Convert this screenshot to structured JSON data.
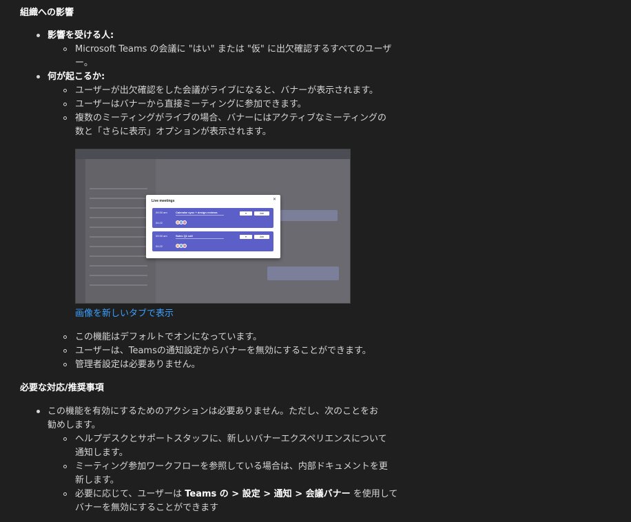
{
  "section1": {
    "heading": "組織への影響",
    "who": {
      "label": "影響を受ける人:",
      "items": [
        [
          "Microsoft Teams の会議に \"はい\" または \"仮\" に出欠確認するすべてのユーザ",
          "ー。"
        ]
      ]
    },
    "what": {
      "label": "何が起こるか:",
      "items": [
        [
          "ユーザーが出欠確認をした会議がライブになると、バナーが表示されます。"
        ],
        [
          "ユーザーはバナーから直接ミーティングに参加できます。"
        ],
        [
          "複数のミーティングがライブの場合、バナーにはアクティブなミーティングの",
          "数と「さらに表示」オプションが表示されます。"
        ]
      ],
      "image_link": "画像を新しいタブで表示",
      "after_items": [
        "この機能はデフォルトでオンになっています。",
        "ユーザーは、Teamsの通知設定からバナーを無効にすることができます。",
        "管理者設定は必要ありません。"
      ]
    }
  },
  "thumbnail": {
    "dialog_title": "Live meetings",
    "close": "✕",
    "meetings": [
      {
        "time": "09:30 am",
        "title": "Calendar sync + design reviews",
        "timer": "04:22",
        "join": "Join"
      },
      {
        "time": "09:30 am",
        "title": "Sales Q1 call",
        "timer": "04:22",
        "join": "Join"
      }
    ],
    "colors": {
      "accent": "#5b5fc7"
    }
  },
  "section2": {
    "heading": "必要な対応/推奨事項",
    "intro": [
      "この機能を有効にするためのアクションは必要ありません。ただし、次のことをお",
      "勧めします。"
    ],
    "items": [
      [
        "ヘルプデスクとサポートスタッフに、新しいバナーエクスペリエンスについて",
        "通知します。"
      ],
      [
        "ミーティング参加ワークフローを参照している場合は、内部ドキュメントを更",
        "新します。"
      ]
    ],
    "last_item": {
      "prefix": "必要に応じて、ユーザーは ",
      "bold": "Teams の > 設定 > 通知 > 会議バナー",
      "suffix": " を使用して",
      "line2": "バナーを無効にすることができます"
    }
  }
}
